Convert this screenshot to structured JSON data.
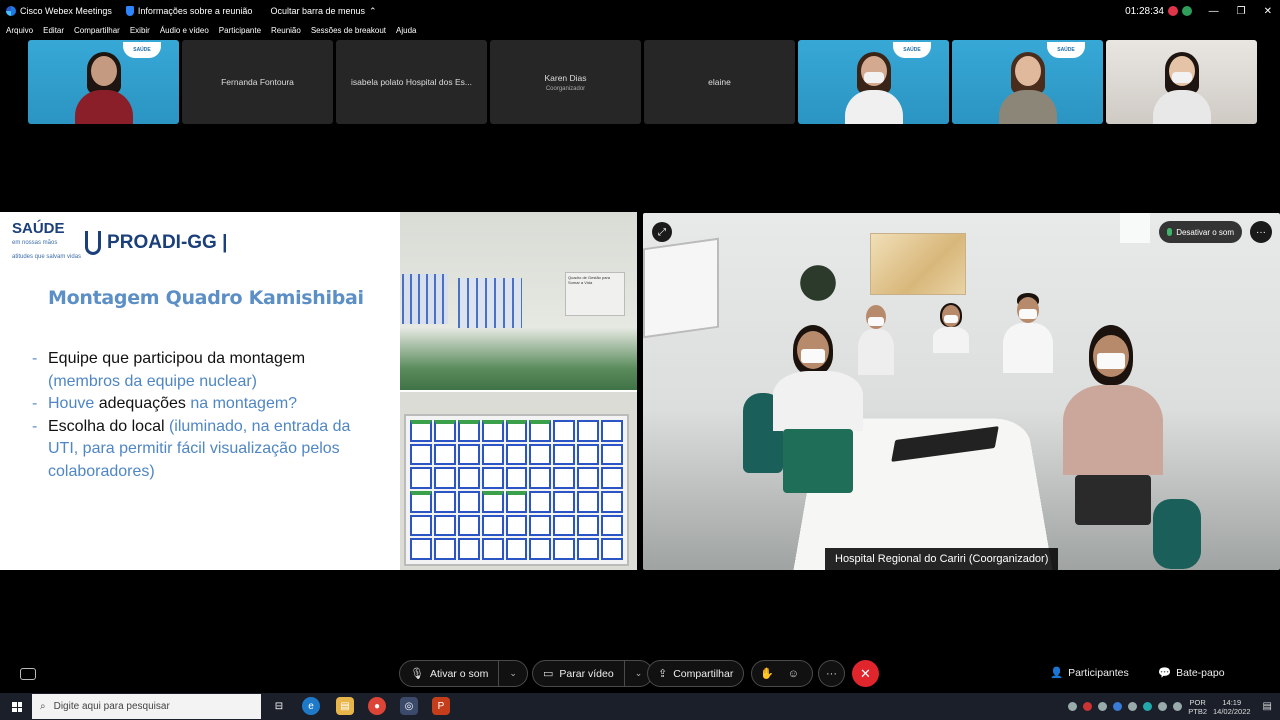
{
  "titlebar": {
    "app_title": "Cisco Webex Meetings",
    "info": "Informações sobre a reunião",
    "hide_menu": "Ocultar barra de menus",
    "timer": "01:28:34"
  },
  "menu": [
    "Arquivo",
    "Editar",
    "Compartilhar",
    "Exibir",
    "Áudio e vídeo",
    "Participante",
    "Reunião",
    "Sessões de breakout",
    "Ajuda"
  ],
  "participants": [
    {
      "name": "",
      "role": "",
      "video": true,
      "badge": "SAÚDE"
    },
    {
      "name": "Fernanda Fontoura",
      "role": "",
      "video": false
    },
    {
      "name": "isabela polato Hospital dos Es...",
      "role": "",
      "video": false
    },
    {
      "name": "Karen Dias",
      "role": "Coorganizador",
      "video": false
    },
    {
      "name": "elaine",
      "role": "",
      "video": false
    },
    {
      "name": "",
      "role": "",
      "video": true,
      "badge": "SAÚDE"
    },
    {
      "name": "",
      "role": "",
      "video": true,
      "badge": "SAÚDE"
    },
    {
      "name": "",
      "role": "",
      "video": true
    }
  ],
  "slide": {
    "brand_saude": "SAÚDE",
    "brand_tagline": "em nossas mãos",
    "brand_sub": "atitudes que salvam vidas",
    "brand_program": "PROADI-GG |",
    "title": "Montagem Quadro Kamishibai",
    "bullets": [
      {
        "dark": "Equipe que participou da montagem",
        "blue": "(membros da equipe nuclear)"
      },
      {
        "blue_pre": "Houve",
        "dark": "adequações",
        "blue": "na montagem?"
      },
      {
        "dark": "Escolha do local",
        "blue": "(iluminado, na entrada da UTI, para permitir fácil visualização pelos colaboradores)"
      }
    ],
    "photo_sign": "Quadro de Gestão para Somar a Vida"
  },
  "remote_video": {
    "mute_label": "Desativar o som",
    "name_label": "Hospital Regional do Cariri  (Coorganizador)"
  },
  "controls": {
    "mute": "Ativar o som",
    "video": "Parar vídeo",
    "share": "Compartilhar",
    "participants": "Participantes",
    "chat": "Bate-papo"
  },
  "taskbar": {
    "search_placeholder": "Digite aqui para pesquisar",
    "lang": "POR",
    "kb": "PTB2",
    "time": "14:19",
    "date": "14/02/2022"
  },
  "colors": {
    "accent_blue": "#5b8fc6",
    "brand_navy": "#1a3f7a",
    "end_red": "#e0262c",
    "unmuted_green": "#3fb46a"
  }
}
